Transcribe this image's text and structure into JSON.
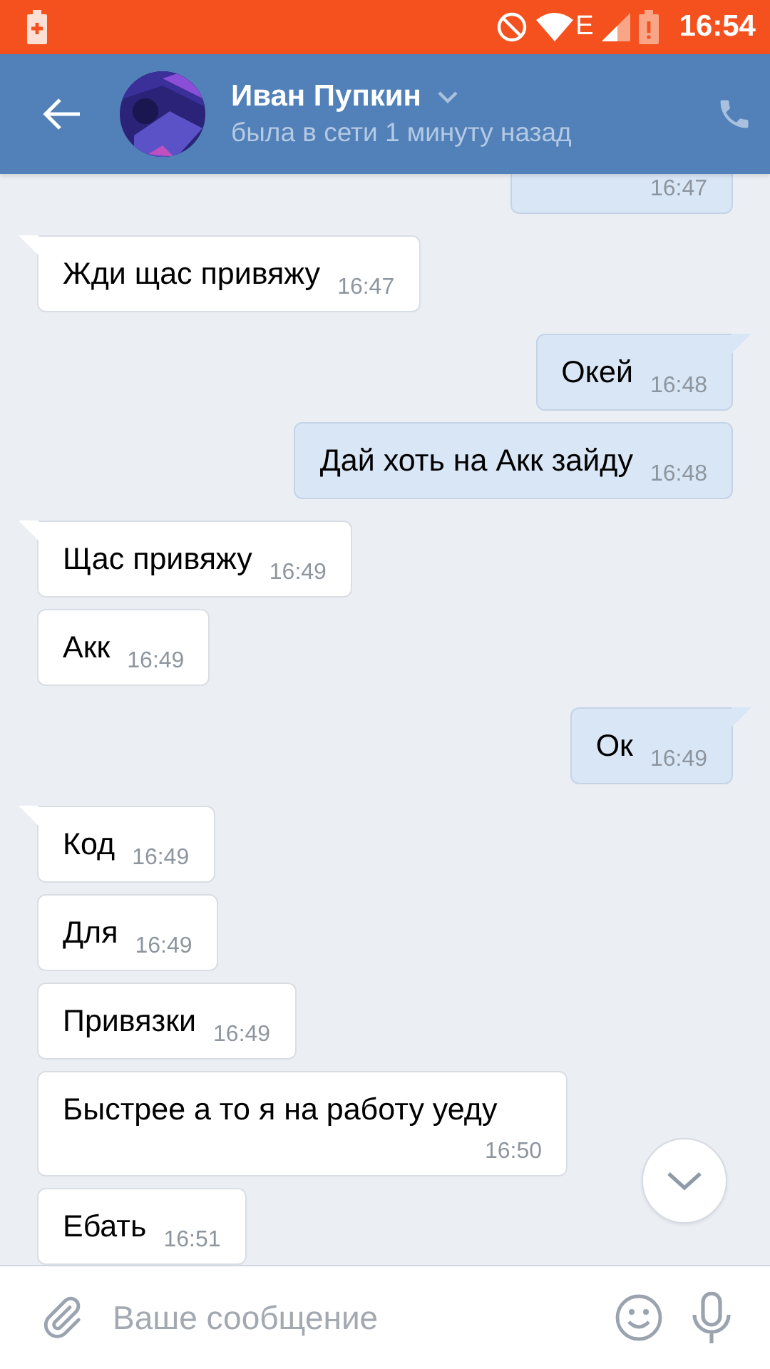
{
  "status_bar": {
    "time": "16:54",
    "network": "E"
  },
  "header": {
    "name": "Иван Пупкин",
    "status": "была в сети 1 минуту назад"
  },
  "messages": [
    {
      "time": "16:47",
      "outgoing": true
    },
    {
      "text": "Жди щас привяжу",
      "time": "16:47",
      "outgoing": false,
      "tail": true
    },
    {
      "text": "Окей",
      "time": "16:48",
      "outgoing": true,
      "tail": true
    },
    {
      "text": "Дай хоть на Акк зайду",
      "time": "16:48",
      "outgoing": true,
      "tail": false
    },
    {
      "text": "Щас привяжу",
      "time": "16:49",
      "outgoing": false,
      "tail": true
    },
    {
      "text": "Акк",
      "time": "16:49",
      "outgoing": false,
      "tail": false
    },
    {
      "text": "Ок",
      "time": "16:49",
      "outgoing": true,
      "tail": true
    },
    {
      "text": "Код",
      "time": "16:49",
      "outgoing": false,
      "tail": true
    },
    {
      "text": "Для",
      "time": "16:49",
      "outgoing": false,
      "tail": false
    },
    {
      "text": "Привязки",
      "time": "16:49",
      "outgoing": false,
      "tail": false
    },
    {
      "text": "Быстрее а то я на работу уеду",
      "time": "16:50",
      "outgoing": false,
      "tail": false
    },
    {
      "text": "Ебать",
      "time": "16:51",
      "outgoing": false,
      "tail": false
    }
  ],
  "composer": {
    "placeholder": "Ваше сообщение"
  }
}
